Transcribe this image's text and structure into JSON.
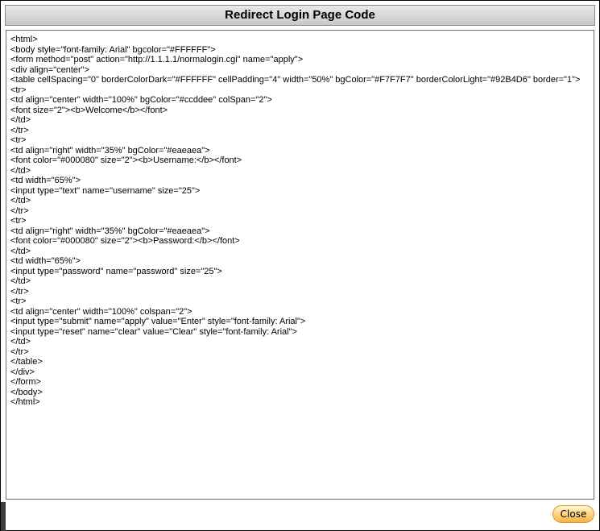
{
  "dialog": {
    "title": "Redirect Login Page Code",
    "close_label": "Close"
  },
  "code_lines": [
    "<html>",
    "<body style=\"font-family: Arial\" bgcolor=\"#FFFFFF\">",
    "<form method=\"post\" action=\"http://1.1.1.1/normalogin.cgi\" name=\"apply\">",
    "<div align=\"center\">",
    "<table cellSpacing=\"0\" borderColorDark=\"#FFFFFF\" cellPadding=\"4\" width=\"50%\" bgColor=\"#F7F7F7\" borderColorLight=\"#92B4D6\" border=\"1\">",
    "<tr>",
    "<td align=\"center\" width=\"100%\" bgColor=\"#ccddee\" colSpan=\"2\">",
    "<font size=\"2\"><b>Welcome</b></font>",
    "</td>",
    "</tr>",
    "<tr>",
    "<td align=\"right\" width=\"35%\" bgColor=\"#eaeaea\">",
    "<font color=\"#000080\" size=\"2\"><b>Username:</b></font>",
    "</td>",
    "<td width=\"65%\">",
    "<input type=\"text\" name=\"username\" size=\"25\">",
    "</td>",
    "</tr>",
    "<tr>",
    "<td align=\"right\" width=\"35%\" bgColor=\"#eaeaea\">",
    "<font color=\"#000080\" size=\"2\"><b>Password:</b></font>",
    "</td>",
    "<td width=\"65%\">",
    "<input type=\"password\" name=\"password\" size=\"25\">",
    "</td>",
    "</tr>",
    "<tr>",
    "<td align=\"center\" width=\"100%\" colspan=\"2\">",
    "<input type=\"submit\" name=\"apply\" value=\"Enter\" style=\"font-family: Arial\">",
    "<input type=\"reset\" name=\"clear\" value=\"Clear\" style=\"font-family: Arial\">",
    "</td>",
    "</tr>",
    "</table>",
    "</div>",
    "</form>",
    "</body>",
    "</html>"
  ]
}
